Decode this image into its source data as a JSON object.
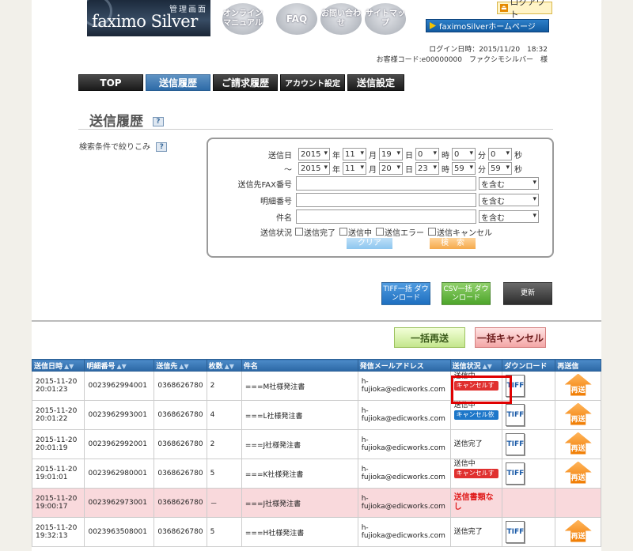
{
  "header": {
    "logo_sub": "管理画面",
    "logo_brand": "faximo Silver",
    "online_manual": "オンライン マニュアル",
    "faq": "FAQ",
    "contact": "お問い合わせ",
    "sitemap": "サイトマップ",
    "logout": "ログアウト",
    "home": "faximoSilverホームページ"
  },
  "info": {
    "login_time": "ログイン日時：2015/11/20　18:32",
    "customer": "お客様コード:e00000000　ファクシモシルバー　様"
  },
  "nav": [
    "TOP",
    "送信履歴",
    "ご請求履歴",
    "アカウント設定",
    "送信設定"
  ],
  "page_title": "送信履歴",
  "filter_label": "検索条件で絞りこみ",
  "search": {
    "date_label": "送信日",
    "from": {
      "year": "2015",
      "month": "11",
      "day": "19",
      "hour": "0",
      "min": "0",
      "sec": "0"
    },
    "to": {
      "year": "2015",
      "month": "11",
      "day": "20",
      "hour": "23",
      "min": "59",
      "sec": "59"
    },
    "tilde": "～",
    "u_year": "年",
    "u_month": "月",
    "u_day": "日",
    "u_hour": "時",
    "u_min": "分",
    "u_sec": "秒",
    "fax_label": "送信先FAX番号",
    "detail_label": "明細番号",
    "subject_label": "件名",
    "contains": "を含む",
    "status_label": "送信状況",
    "status_options": [
      "送信完了",
      "送信中",
      "送信エラー",
      "送信キャンセル"
    ],
    "clear": "クリア",
    "search": "検　索"
  },
  "actions": {
    "tiff_dl": "TIFF一括 ダウンロード",
    "csv_dl": "CSV一括 ダウンロード",
    "refresh": "更新",
    "bulk_resend": "一括再送",
    "bulk_cancel": "一括キャンセル"
  },
  "table": {
    "headers": [
      "送信日時",
      "明細番号",
      "送信先",
      "枚数",
      "件名",
      "発信メールアドレス",
      "送信状況",
      "ダウンロード",
      "再送信"
    ],
    "rows": [
      {
        "date": "2015-11-20",
        "time": "20:01:23",
        "id": "0023962994001",
        "to": "0368626780",
        "pages": "2",
        "subject": "===M社様発注書",
        "email": "h-fujioka@edicworks.com",
        "status": "送信中",
        "badge": "キャンセルする",
        "badge_type": "red",
        "tiff": true,
        "resend": true,
        "pink": false
      },
      {
        "date": "2015-11-20",
        "time": "20:01:22",
        "id": "0023962993001",
        "to": "0368626780",
        "pages": "4",
        "subject": "===L社様発注書",
        "email": "h-fujioka@edicworks.com",
        "status": "送信中",
        "badge": "キャンセル依頼中",
        "badge_type": "blue",
        "tiff": true,
        "resend": true,
        "pink": false
      },
      {
        "date": "2015-11-20",
        "time": "20:01:19",
        "id": "0023962992001",
        "to": "0368626780",
        "pages": "2",
        "subject": "===J社様発注書",
        "email": "h-fujioka@edicworks.com",
        "status": "送信完了",
        "badge": "",
        "badge_type": "",
        "tiff": true,
        "resend": true,
        "pink": false
      },
      {
        "date": "2015-11-20",
        "time": "19:01:01",
        "id": "0023962980001",
        "to": "0368626780",
        "pages": "5",
        "subject": "===K社様発注書",
        "email": "h-fujioka@edicworks.com",
        "status": "送信中",
        "badge": "キャンセルする",
        "badge_type": "red",
        "tiff": true,
        "resend": true,
        "pink": false
      },
      {
        "date": "2015-11-20",
        "time": "19:00:17",
        "id": "0023962973001",
        "to": "0368626780",
        "pages": "－",
        "subject": "===J社様発注書",
        "email": "h-fujioka@edicworks.com",
        "status": "送信書類なし",
        "badge": "",
        "badge_type": "",
        "tiff": false,
        "resend": false,
        "pink": true
      },
      {
        "date": "2015-11-20",
        "time": "19:32:13",
        "id": "0023963508001",
        "to": "0368626780",
        "pages": "5",
        "subject": "===H社様発注書",
        "email": "h-fujioka@edicworks.com",
        "status": "送信完了",
        "badge": "",
        "badge_type": "",
        "tiff": true,
        "resend": true,
        "pink": false
      }
    ],
    "tiff_label": "TIFF",
    "resend_label": "再送"
  }
}
